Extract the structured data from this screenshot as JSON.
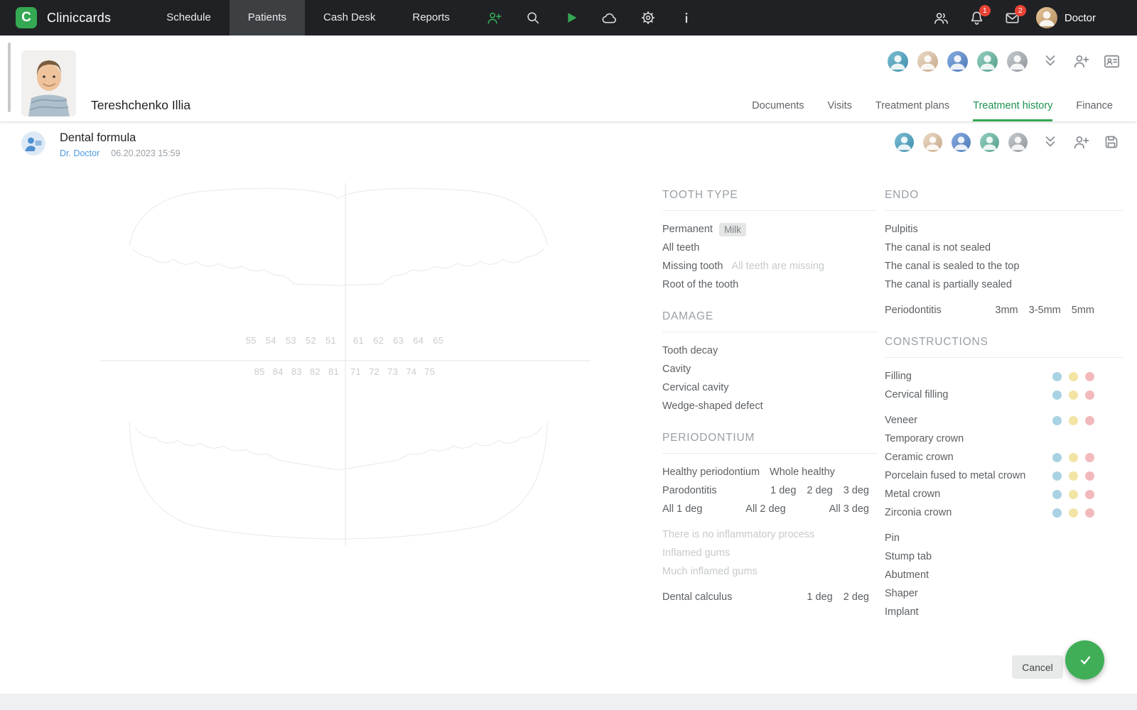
{
  "topbar": {
    "brand": "Cliniccards",
    "nav": [
      {
        "label": "Schedule",
        "active": false
      },
      {
        "label": "Patients",
        "active": true
      },
      {
        "label": "Cash Desk",
        "active": false
      },
      {
        "label": "Reports",
        "active": false
      }
    ],
    "icons": [
      "add-patient",
      "search",
      "play",
      "cloud",
      "settings",
      "info",
      "contacts",
      "notifications",
      "mail"
    ],
    "badges": {
      "notifications": "1",
      "messages": "2"
    },
    "user": "Doctor"
  },
  "patient": {
    "name": "Tereshchenko Illia",
    "tabs": [
      {
        "label": "Documents",
        "active": false
      },
      {
        "label": "Visits",
        "active": false
      },
      {
        "label": "Treatment plans",
        "active": false
      },
      {
        "label": "Treatment history",
        "active": true
      },
      {
        "label": "Finance",
        "active": false
      }
    ]
  },
  "card": {
    "title": "Dental formula",
    "doctor": "Dr. Doctor",
    "datetime": "06.20.2023 15:59"
  },
  "chart": {
    "upper_teeth": [
      "55",
      "54",
      "53",
      "52",
      "51",
      "61",
      "62",
      "63",
      "64",
      "65"
    ],
    "lower_teeth": [
      "85",
      "84",
      "83",
      "82",
      "81",
      "71",
      "72",
      "73",
      "74",
      "75"
    ]
  },
  "sections_col1": [
    {
      "title": "TOOTH TYPE",
      "rows": [
        {
          "label": "Permanent",
          "chip": "Milk"
        },
        {
          "label": "All teeth"
        },
        {
          "label": "Missing tooth",
          "note": "All teeth are missing"
        },
        {
          "label": "Root of the tooth"
        }
      ]
    },
    {
      "title": "DAMAGE",
      "rows": [
        {
          "label": "Tooth decay"
        },
        {
          "label": "Cavity"
        },
        {
          "label": "Cervical cavity"
        },
        {
          "label": "Wedge-shaped defect"
        }
      ]
    },
    {
      "title": "PERIODONTIUM",
      "rows": [
        {
          "label": "Healthy periodontium",
          "inline": [
            "Whole healthy"
          ]
        },
        {
          "label": "Parodontitis",
          "right": [
            "1 deg",
            "2 deg",
            "3 deg"
          ]
        },
        {
          "spread": true,
          "items": [
            "All 1 deg",
            "All 2 deg",
            "All 3 deg"
          ]
        },
        {
          "label": "There is no inflammatory process",
          "disabled": true,
          "gap": true
        },
        {
          "label": "Inflamed gums",
          "disabled": true
        },
        {
          "label": "Much inflamed gums",
          "disabled": true
        },
        {
          "label": "Dental calculus",
          "right": [
            "1 deg",
            "2 deg"
          ],
          "gap": true
        }
      ]
    }
  ],
  "sections_col2": [
    {
      "title": "ENDO",
      "rows": [
        {
          "label": "Pulpitis"
        },
        {
          "label": "The canal is not sealed"
        },
        {
          "label": "The canal is sealed to the top"
        },
        {
          "label": "The canal is partially sealed"
        },
        {
          "label": "Periodontitis",
          "right": [
            "3mm",
            "3-5mm",
            "5mm"
          ],
          "gap": true
        }
      ]
    },
    {
      "title": "CONSTRUCTIONS",
      "rows": [
        {
          "label": "Filling",
          "dots": true
        },
        {
          "label": "Cervical filling",
          "dots": true
        },
        {
          "label": "Veneer",
          "dots": true,
          "gap": true
        },
        {
          "label": "Temporary crown"
        },
        {
          "label": "Ceramic crown",
          "dots": true
        },
        {
          "label": "Porcelain fused to metal crown",
          "dots": true
        },
        {
          "label": "Metal crown",
          "dots": true
        },
        {
          "label": "Zirconia crown",
          "dots": true
        },
        {
          "label": "Pin",
          "gap": true
        },
        {
          "label": "Stump tab"
        },
        {
          "label": "Abutment"
        },
        {
          "label": "Shaper"
        },
        {
          "label": "Implant"
        }
      ]
    }
  ],
  "dot_colors": [
    "#a9d2e2",
    "#f2e4a4",
    "#f2b9bc"
  ],
  "avatar_colors": [
    {
      "from": "#79bdd2",
      "to": "#3f8fae"
    },
    {
      "from": "#ead9c6",
      "to": "#c7a98b"
    },
    {
      "from": "#86abdf",
      "to": "#4d79b8"
    },
    {
      "from": "#93cfc0",
      "to": "#569f8d"
    },
    {
      "from": "#c6cacd",
      "to": "#8f969c"
    }
  ],
  "colors": {
    "accent_green": "#34a853",
    "badge_red": "#e94235",
    "active_tab_green": "#1e9150"
  },
  "actions": {
    "cancel": "Cancel",
    "confirm_icon": "check"
  }
}
